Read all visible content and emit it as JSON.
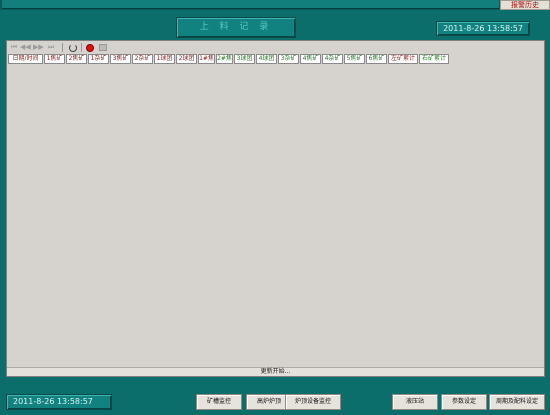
{
  "header": {
    "alarm_history": "报警历史",
    "title": "上 料 记 录",
    "clock": "2011-8-26 13:58:57"
  },
  "toolbar": {
    "icons": [
      "first-record-icon",
      "previous-record-icon",
      "next-record-icon",
      "last-record-icon",
      "refresh-icon",
      "stop-icon",
      "print-icon"
    ]
  },
  "table": {
    "columns": [
      {
        "label": "日期/时间",
        "color": "#8b1a1a"
      },
      {
        "label": "1焦矿",
        "color": "#8b1a1a"
      },
      {
        "label": "2焦矿",
        "color": "#8b1a1a"
      },
      {
        "label": "1杂矿",
        "color": "#8b1a1a"
      },
      {
        "label": "3焦矿",
        "color": "#8b1a1a"
      },
      {
        "label": "2杂矿",
        "color": "#8b1a1a"
      },
      {
        "label": "1球团",
        "color": "#8b1a1a"
      },
      {
        "label": "2球团",
        "color": "#8b1a1a"
      },
      {
        "label": "1#焦",
        "color": "#8b1a1a"
      },
      {
        "label": "2#焦",
        "color": "#1f7a1f"
      },
      {
        "label": "3球团",
        "color": "#1f7a1f"
      },
      {
        "label": "4球团",
        "color": "#1f7a1f"
      },
      {
        "label": "3杂矿",
        "color": "#1f7a1f"
      },
      {
        "label": "4焦矿",
        "color": "#1f7a1f"
      },
      {
        "label": "4杂矿",
        "color": "#1f7a1f"
      },
      {
        "label": "5焦矿",
        "color": "#1f7a1f"
      },
      {
        "label": "6焦矿",
        "color": "#1f7a1f"
      },
      {
        "label": "左矿累计",
        "color": "#8b1a1a"
      },
      {
        "label": "右矿累计",
        "color": "#1f7a1f"
      }
    ]
  },
  "status": "更新开始...",
  "footer": {
    "clock": "2011-8-26 13:58:57",
    "nav": [
      "矿槽监控",
      "高炉炉顶",
      "炉顶设备监控",
      "液压站",
      "参数设定",
      "周期及配料设定"
    ]
  }
}
